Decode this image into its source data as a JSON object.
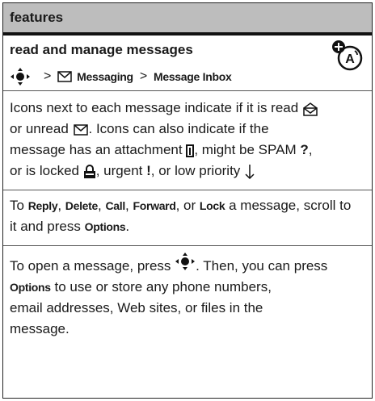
{
  "header": {
    "title": "features"
  },
  "feature": {
    "title": "read and manage messages",
    "icon": "network-feature-icon"
  },
  "path": {
    "nav_icon": "nav-key-icon",
    "sep": ">",
    "messaging_icon": "envelope-icon",
    "messaging": "Messaging",
    "inbox": "Message Inbox"
  },
  "para1": {
    "t1": "Icons next to each message indicate if it is read",
    "t2": "or unread",
    "t3": ". Icons can also indicate if the",
    "t4": "message has an attachment",
    "t5": ", might be SPAM",
    "spam_mark": "?",
    "t6": ",",
    "t7": "or is locked",
    "t8": ", urgent",
    "urgent_mark": "!",
    "t9": ", or low priority"
  },
  "para2": {
    "t1": "To",
    "reply": "Reply",
    "c1": ",",
    "delete": "Delete",
    "c2": ",",
    "call": "Call",
    "c3": ",",
    "forward": "Forward",
    "c4": ", or",
    "lock": "Lock",
    "t2": "a message, scroll to",
    "t3": "it and press",
    "options": "Options",
    "t4": "."
  },
  "para3": {
    "t1": "To open a message, press",
    "t2": ". Then, you can press",
    "options": "Options",
    "t3": "to use or store any phone numbers,",
    "t4": "email addresses, Web sites, or files in the",
    "t5": "message."
  }
}
